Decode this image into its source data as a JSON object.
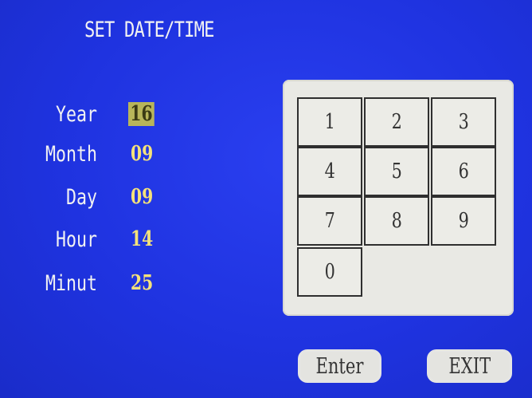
{
  "title": "SET DATE/TIME",
  "fields": [
    {
      "label": "Year",
      "value": "16"
    },
    {
      "label": "Month",
      "value": "09"
    },
    {
      "label": "Day",
      "value": "09"
    },
    {
      "label": "Hour",
      "value": "14"
    },
    {
      "label": "Minut",
      "value": "25"
    }
  ],
  "keypad": {
    "keys": [
      "1",
      "2",
      "3",
      "4",
      "5",
      "6",
      "7",
      "8",
      "9",
      "0"
    ]
  },
  "buttons": {
    "enter": "Enter",
    "exit": "EXIT"
  },
  "colors": {
    "screen_bg": "#1f33e0",
    "label_text": "#f2f2f2",
    "value_text": "#f5e27a",
    "active_value_bg": "#b8b55a",
    "keypad_bg": "#e9e9e4"
  }
}
